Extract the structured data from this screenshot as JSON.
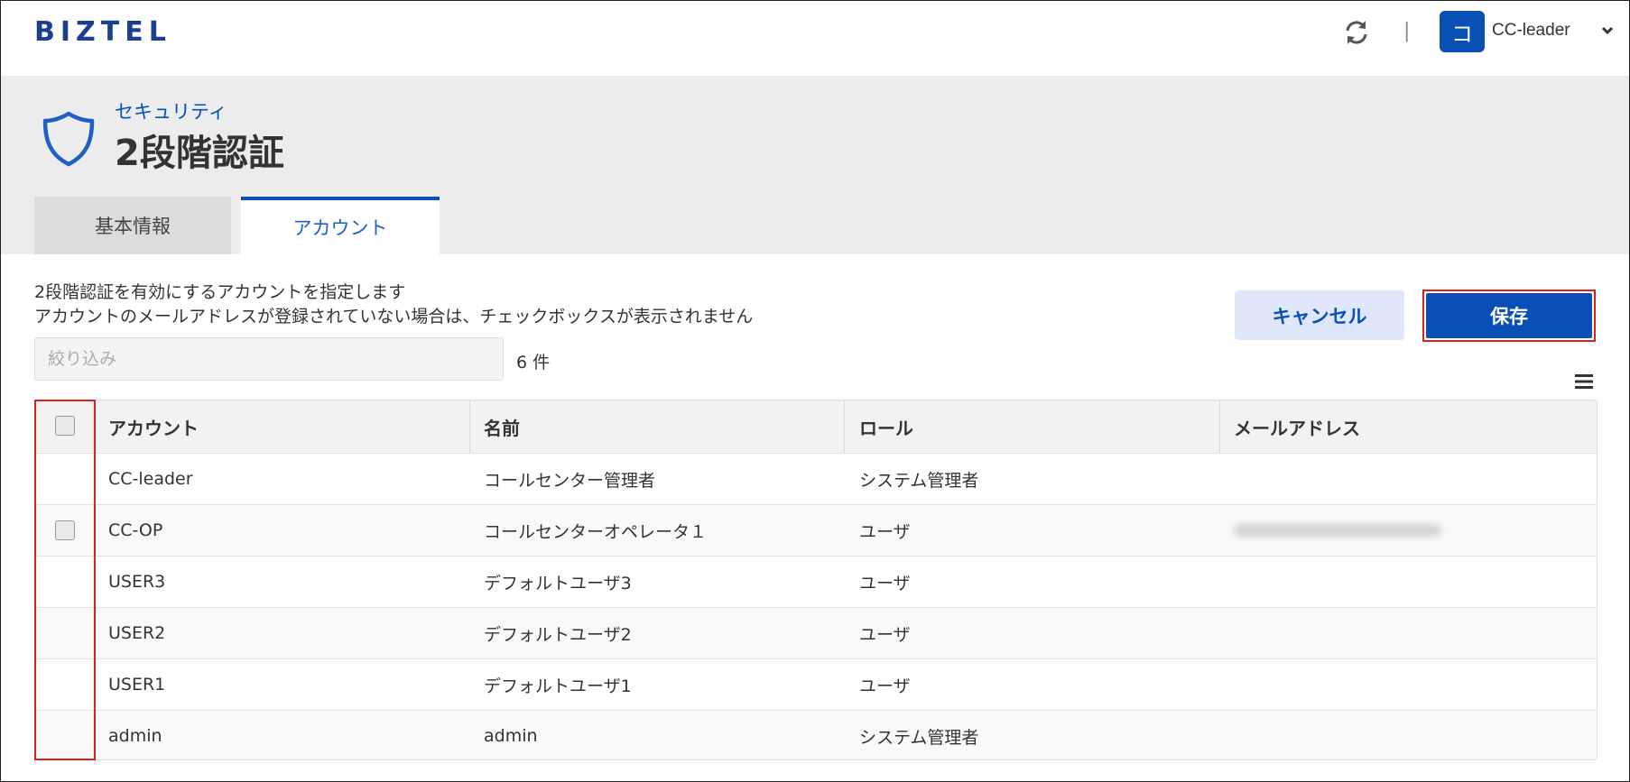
{
  "app": {
    "logo": "BIZTEL"
  },
  "user": {
    "avatar_initial": "コ",
    "name": "CC-leader"
  },
  "header": {
    "category": "セキュリティ",
    "title": "2段階認証"
  },
  "tabs": [
    {
      "label": "基本情報",
      "active": false
    },
    {
      "label": "アカウント",
      "active": true
    }
  ],
  "content": {
    "description_line1": "2段階認証を有効にするアカウントを指定します",
    "description_line2": "アカウントのメールアドレスが登録されていない場合は、チェックボックスが表示されません",
    "filter_placeholder": "絞り込み",
    "filter_value": "",
    "count_text": "6 件",
    "cancel_label": "キャンセル",
    "save_label": "保存"
  },
  "table": {
    "columns": [
      "アカウント",
      "名前",
      "ロール",
      "メールアドレス"
    ],
    "rows": [
      {
        "account": "CC-leader",
        "name": "コールセンター管理者",
        "role": "システム管理者",
        "has_checkbox": false,
        "email_blurred": false
      },
      {
        "account": "CC-OP",
        "name": "コールセンターオペレータ１",
        "role": "ユーザ",
        "has_checkbox": true,
        "email_blurred": true
      },
      {
        "account": "USER3",
        "name": "デフォルトユーザ3",
        "role": "ユーザ",
        "has_checkbox": false,
        "email_blurred": false
      },
      {
        "account": "USER2",
        "name": "デフォルトユーザ2",
        "role": "ユーザ",
        "has_checkbox": false,
        "email_blurred": false
      },
      {
        "account": "USER1",
        "name": "デフォルトユーザ1",
        "role": "ユーザ",
        "has_checkbox": false,
        "email_blurred": false
      },
      {
        "account": "admin",
        "name": "admin",
        "role": "システム管理者",
        "has_checkbox": false,
        "email_blurred": false
      }
    ]
  },
  "icons": {
    "refresh": "refresh-icon",
    "chevron": "chevron-down-icon",
    "shield": "shield-icon",
    "menu": "menu-icon"
  },
  "colors": {
    "brand": "#1d3f8f",
    "accent": "#0a4fb5",
    "highlight": "#e0201b"
  }
}
